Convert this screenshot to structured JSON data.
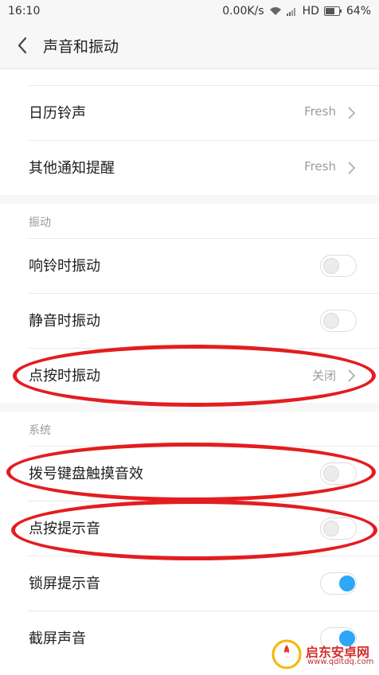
{
  "status_bar": {
    "time": "16:10",
    "network_speed": "0.00K/s",
    "hd": "HD",
    "battery": "64%"
  },
  "header": {
    "title": "声音和振动"
  },
  "ringtones": [
    {
      "label": "日历铃声",
      "value": "Fresh"
    },
    {
      "label": "其他通知提醒",
      "value": "Fresh"
    }
  ],
  "vibration": {
    "header": "振动",
    "items": [
      {
        "label": "响铃时振动",
        "state": "off"
      },
      {
        "label": "静音时振动",
        "state": "off"
      },
      {
        "label": "点按时振动",
        "value": "关闭"
      }
    ]
  },
  "system": {
    "header": "系统",
    "items": [
      {
        "label": "拨号键盘触摸音效",
        "state": "off"
      },
      {
        "label": "点按提示音",
        "state": "off"
      },
      {
        "label": "锁屏提示音",
        "state": "on"
      },
      {
        "label": "截屏声音",
        "state": "on"
      }
    ]
  },
  "watermark": {
    "name": "启东安卓网",
    "url": "www.qdltdq.com"
  },
  "colors": {
    "accent": "#2ea7f8",
    "highlight": "#e31d20"
  }
}
